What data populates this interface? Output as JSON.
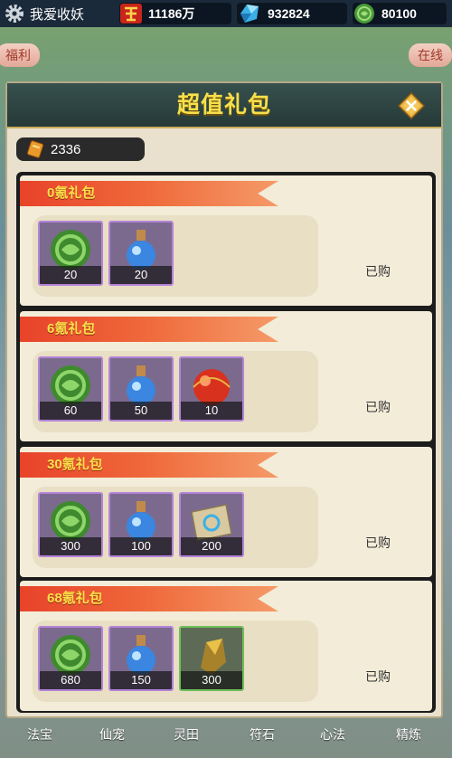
{
  "game": {
    "title": "我爱收妖"
  },
  "resources": [
    {
      "icon": "war-power-icon",
      "value": "11186万"
    },
    {
      "icon": "crystal-icon",
      "value": "932824"
    },
    {
      "icon": "jade-coin-icon",
      "value": "80100"
    }
  ],
  "side_tabs": {
    "left": "福利",
    "right": "在线"
  },
  "modal": {
    "title": "超值礼包",
    "close_icon": "close-icon",
    "currency": {
      "icon": "voucher-icon",
      "amount": "2336"
    }
  },
  "packs": [
    {
      "name": "0氪礼包",
      "status": "已购",
      "items": [
        {
          "icon": "jade-coin-icon",
          "qty": "20",
          "frame": "purple"
        },
        {
          "icon": "blue-potion-icon",
          "qty": "20",
          "frame": "purple"
        }
      ]
    },
    {
      "name": "6氪礼包",
      "status": "已购",
      "items": [
        {
          "icon": "jade-coin-icon",
          "qty": "60",
          "frame": "purple"
        },
        {
          "icon": "blue-potion-icon",
          "qty": "50",
          "frame": "purple"
        },
        {
          "icon": "red-orb-icon",
          "qty": "10",
          "frame": "purple"
        }
      ]
    },
    {
      "name": "30氪礼包",
      "status": "已购",
      "items": [
        {
          "icon": "jade-coin-icon",
          "qty": "300",
          "frame": "purple"
        },
        {
          "icon": "blue-potion-icon",
          "qty": "100",
          "frame": "purple"
        },
        {
          "icon": "scroll-icon",
          "qty": "200",
          "frame": "purple"
        }
      ]
    },
    {
      "name": "68氪礼包",
      "status": "已购",
      "items": [
        {
          "icon": "jade-coin-icon",
          "qty": "680",
          "frame": "purple"
        },
        {
          "icon": "blue-potion-icon",
          "qty": "150",
          "frame": "purple"
        },
        {
          "icon": "gold-stone-icon",
          "qty": "300",
          "frame": "green"
        }
      ]
    }
  ],
  "bottom_nav": [
    "法宝",
    "仙宠",
    "灵田",
    "符石",
    "心法",
    "精炼"
  ],
  "colors": {
    "title": "#f6e04a",
    "ribbon": "#e8432a",
    "ribbon_text": "#ffe04a",
    "item_frame": "#b483d8"
  }
}
